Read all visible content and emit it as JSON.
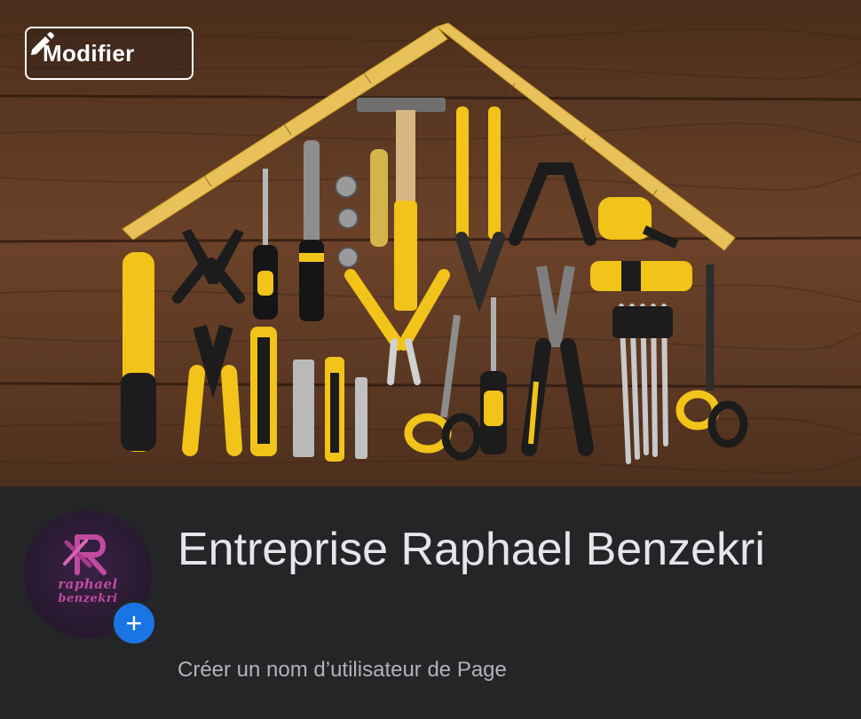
{
  "cover": {
    "edit_button_label": "Modifier",
    "edit_icon": "pencil-icon",
    "image_subject": "tools-arranged-as-house"
  },
  "profile": {
    "avatar_text_line1": "raphael",
    "avatar_text_line2": "benzekri",
    "add_icon": "plus-icon",
    "add_label": "+",
    "page_name": "Entreprise Raphael Benzekri",
    "username_prompt": "Créer un nom d’utilisateur de Page"
  },
  "colors": {
    "background": "#242526",
    "accent": "#1b74e4",
    "title_text": "#e4e6eb",
    "secondary_text": "#b0b3b8",
    "tool_yellow": "#f2c318",
    "wood": "#5a3722"
  }
}
